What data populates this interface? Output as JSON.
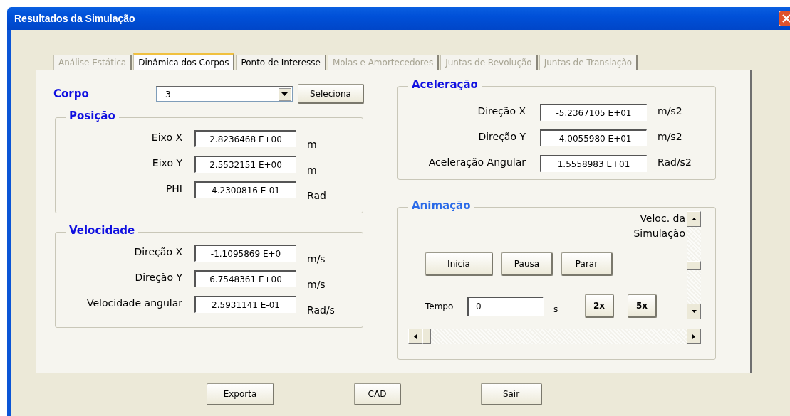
{
  "window": {
    "title": "Resultados da Simulação"
  },
  "tabs": [
    {
      "label": "Análise Estática",
      "selected": false,
      "disabled": true
    },
    {
      "label": "Dinâmica dos Corpos",
      "selected": true,
      "disabled": false
    },
    {
      "label": "Ponto de Interesse",
      "selected": false,
      "disabled": false
    },
    {
      "label": "Molas e Amortecedores",
      "selected": false,
      "disabled": true
    },
    {
      "label": "Juntas de Revolução",
      "selected": false,
      "disabled": true
    },
    {
      "label": "Juntas de Translação",
      "selected": false,
      "disabled": true
    }
  ],
  "corpo": {
    "label": "Corpo",
    "value": "3",
    "button": "Seleciona"
  },
  "posicao": {
    "title": "Posição",
    "rows": [
      {
        "label": "Eixo X",
        "value": "2.8236468 E+00",
        "unit": "m"
      },
      {
        "label": "Eixo Y",
        "value": "2.5532151 E+00",
        "unit": "m"
      },
      {
        "label": "PHI",
        "value": "4.2300816 E-01",
        "unit": "Rad"
      }
    ]
  },
  "velocidade": {
    "title": "Velocidade",
    "rows": [
      {
        "label": "Direção X",
        "value": "-1.1095869 E+0",
        "unit": "m/s"
      },
      {
        "label": "Direção Y",
        "value": "6.7548361 E+00",
        "unit": "m/s"
      },
      {
        "label": "Velocidade angular",
        "value": "2.5931141 E-01",
        "unit": "Rad/s"
      }
    ]
  },
  "aceleracao": {
    "title": "Aceleração",
    "rows": [
      {
        "label": "Direção X",
        "value": "-5.2367105 E+01",
        "unit": "m/s2"
      },
      {
        "label": "Direção Y",
        "value": "-4.0055980 E+01",
        "unit": "m/s2"
      },
      {
        "label": "Aceleração Angular",
        "value": "1.5558983 E+01",
        "unit": "Rad/s2"
      }
    ]
  },
  "animacao": {
    "title": "Animação",
    "speed_label": "Veloc. da Simulação",
    "buttons": [
      "Inicia",
      "Pausa",
      "Parar"
    ],
    "time": {
      "label": "Tempo",
      "value": "0",
      "unit": "s"
    },
    "speed_buttons": [
      "2x",
      "5x"
    ]
  },
  "buttons": [
    "Exporta",
    "CAD",
    "Sair"
  ]
}
